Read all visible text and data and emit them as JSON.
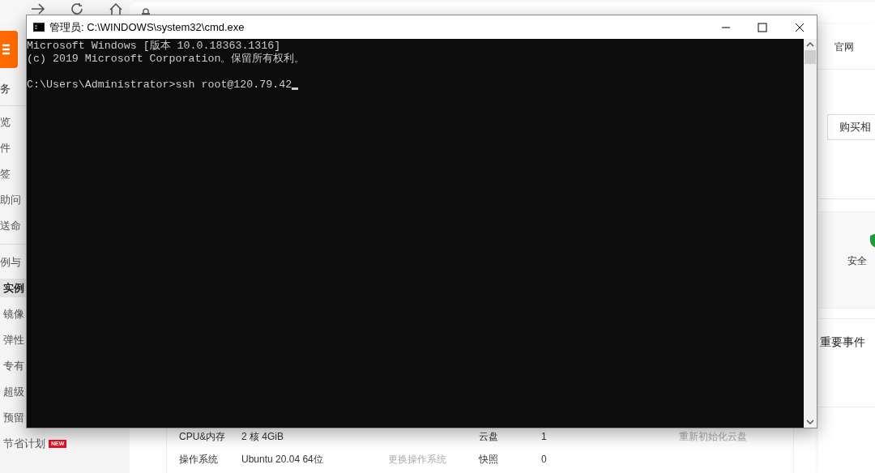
{
  "sidebar": {
    "title": "务",
    "groups": [
      {
        "items": [
          {
            "label": "览",
            "selected": false
          },
          {
            "label": "件",
            "selected": false
          },
          {
            "label": "签",
            "selected": false
          },
          {
            "label": "助问",
            "selected": false
          },
          {
            "label": "送命",
            "selected": false
          }
        ]
      },
      {
        "heading": "例与",
        "items": [
          {
            "label": "实例",
            "selected": true
          },
          {
            "label": "镜像",
            "selected": false
          },
          {
            "label": "弹性",
            "selected": false
          },
          {
            "label": "专有",
            "selected": false
          },
          {
            "label": "超级",
            "selected": false
          },
          {
            "label": "预留",
            "selected": false
          },
          {
            "label": "节省计划",
            "selected": false,
            "badge": "NEW"
          }
        ]
      }
    ]
  },
  "header_links": [
    "官网"
  ],
  "buy_button": "购买相",
  "security": {
    "label": "安全"
  },
  "events": {
    "title": "重要事件"
  },
  "specs": [
    {
      "left": {
        "label": "CPU&内存",
        "value": "2 核 4GiB"
      },
      "right": {
        "label": "云盘",
        "value": "1",
        "action": "重新初始化云盘"
      }
    },
    {
      "left": {
        "label": "操作系统",
        "value": "Ubuntu 20.04 64位",
        "action": "更换操作系统"
      },
      "right": {
        "label": "快照",
        "value": "0"
      }
    }
  ],
  "cmd": {
    "title": "管理员: C:\\WINDOWS\\system32\\cmd.exe",
    "lines": [
      "Microsoft Windows [版本 10.0.18363.1316]",
      "(c) 2019 Microsoft Corporation。保留所有权利。"
    ],
    "prompt": "C:\\Users\\Administrator>ssh root@120.79.42"
  }
}
